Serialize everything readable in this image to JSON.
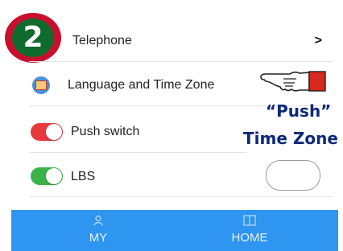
{
  "step_badge": {
    "number": "2"
  },
  "rows": {
    "telephone": {
      "label": "Telephone",
      "chevron": ">"
    },
    "language": {
      "label": "Language and Time Zone"
    },
    "push": {
      "label": "Push switch",
      "toggle_on": true
    },
    "lbs": {
      "label": "LBS",
      "toggle_on": true
    }
  },
  "annotation": {
    "line1": "“Push”",
    "line2": "Time Zone"
  },
  "tabbar": {
    "tabs": [
      {
        "label": "MY",
        "icon": "person-icon"
      },
      {
        "label": "HOME",
        "icon": "book-icon"
      }
    ]
  },
  "colors": {
    "tabbar": "#2e95f0",
    "push_toggle": "#e8393d",
    "lbs_toggle": "#3bb34a",
    "annotation": "#0c2a7a"
  }
}
